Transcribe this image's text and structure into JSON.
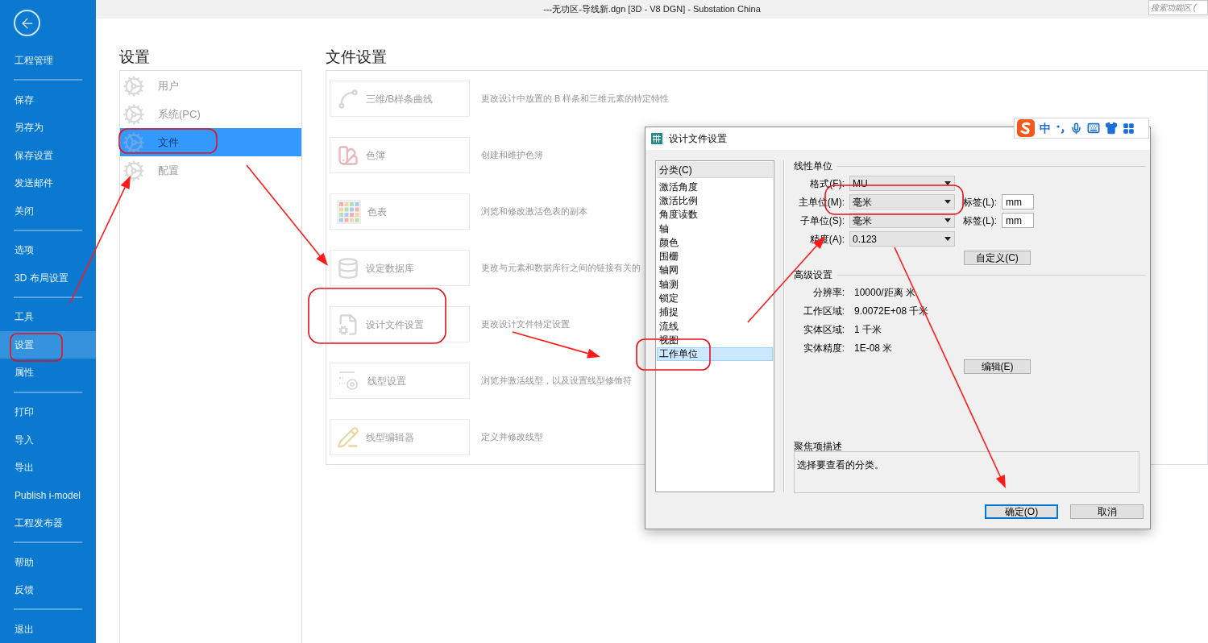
{
  "title_bar": {
    "title": "---无功区-导线新.dgn [3D - V8 DGN] - Substation China",
    "search": {
      "placeholder": "搜索功能区 ("
    }
  },
  "backstage_menu": {
    "groups": [
      [
        {
          "label": "工程管理",
          "selected": false
        }
      ],
      [
        {
          "label": "保存",
          "selected": false
        },
        {
          "label": "另存为",
          "selected": false
        },
        {
          "label": "保存设置",
          "selected": false
        },
        {
          "label": "发送邮件",
          "selected": false
        },
        {
          "label": "关闭",
          "selected": false
        }
      ],
      [
        {
          "label": "选项",
          "selected": false
        },
        {
          "label": "3D 布局设置",
          "selected": false
        }
      ],
      [
        {
          "label": "工具",
          "selected": false
        },
        {
          "label": "设置",
          "selected": true
        },
        {
          "label": "属性",
          "selected": false
        }
      ],
      [
        {
          "label": "打印",
          "selected": false
        },
        {
          "label": "导入",
          "selected": false
        },
        {
          "label": "导出",
          "selected": false
        },
        {
          "label": "Publish i-model",
          "selected": false
        },
        {
          "label": "工程发布器",
          "selected": false
        }
      ],
      [
        {
          "label": "帮助",
          "selected": false
        },
        {
          "label": "反馈",
          "selected": false
        }
      ],
      [
        {
          "label": "退出",
          "selected": false
        }
      ]
    ]
  },
  "settings": {
    "heading": "设置",
    "items": [
      {
        "label": "用户",
        "selected": false
      },
      {
        "label": "系统(PC)",
        "selected": false
      },
      {
        "label": "文件",
        "selected": true
      },
      {
        "label": "配置",
        "selected": false
      }
    ]
  },
  "file_settings": {
    "heading": "文件设置",
    "items": [
      {
        "label": "三维/B样条曲线",
        "description": "更改设计中放置的 B 样条和三维元素的特定特性"
      },
      {
        "label": "色簿",
        "description": "创建和维护色簿"
      },
      {
        "label": "色表",
        "description": "浏览和修改激活色表的副本"
      },
      {
        "label": "设定数据库",
        "description": "更改与元素和数据库行之间的链接有关的"
      },
      {
        "label": "设计文件设置",
        "description": "更改设计文件特定设置"
      },
      {
        "label": "线型设置",
        "description": "浏览并激活线型，以及设置线型修饰符"
      },
      {
        "label": "线型编辑器",
        "description": "定义并修改线型"
      }
    ]
  },
  "dialog": {
    "title": "设计文件设置",
    "category_header": "分类(C)",
    "categories": [
      {
        "label": "激活角度",
        "selected": false
      },
      {
        "label": "激活比例",
        "selected": false
      },
      {
        "label": "角度读数",
        "selected": false
      },
      {
        "label": "轴",
        "selected": false
      },
      {
        "label": "颜色",
        "selected": false
      },
      {
        "label": "围栅",
        "selected": false
      },
      {
        "label": "轴网",
        "selected": false
      },
      {
        "label": "轴测",
        "selected": false
      },
      {
        "label": "锁定",
        "selected": false
      },
      {
        "label": "捕捉",
        "selected": false
      },
      {
        "label": "流线",
        "selected": false
      },
      {
        "label": "视图",
        "selected": false
      },
      {
        "label": "工作单位",
        "selected": true
      }
    ],
    "linear_units": {
      "heading": "线性单位",
      "rows": [
        {
          "label": "格式(F):",
          "value": "MU"
        },
        {
          "label": "主单位(M):",
          "value": "毫米",
          "tag_label": "标签(L):",
          "tag_value": "mm"
        },
        {
          "label": "子单位(S):",
          "value": "毫米",
          "tag_label": "标签(L):",
          "tag_value": "mm"
        },
        {
          "label": "精度(A):",
          "value": "0.123"
        }
      ]
    },
    "custom_button": "自定义(C)",
    "advanced": {
      "heading": "高级设置",
      "rows": [
        {
          "label": "分辨率:",
          "value": "10000/距离 米"
        },
        {
          "label": "工作区域:",
          "value": "9.0072E+08 千米"
        },
        {
          "label": "实体区域:",
          "value": "1 千米"
        },
        {
          "label": "实体精度:",
          "value": "1E-08 米"
        }
      ]
    },
    "edit_button": "编辑(E)",
    "description": {
      "heading": "聚焦项描述",
      "text": "选择要查看的分类。"
    },
    "buttons": [
      {
        "label": "确定(O)",
        "default": true
      },
      {
        "label": "取消",
        "default": false
      }
    ]
  },
  "ime_toolbar": {
    "mode": "中"
  }
}
